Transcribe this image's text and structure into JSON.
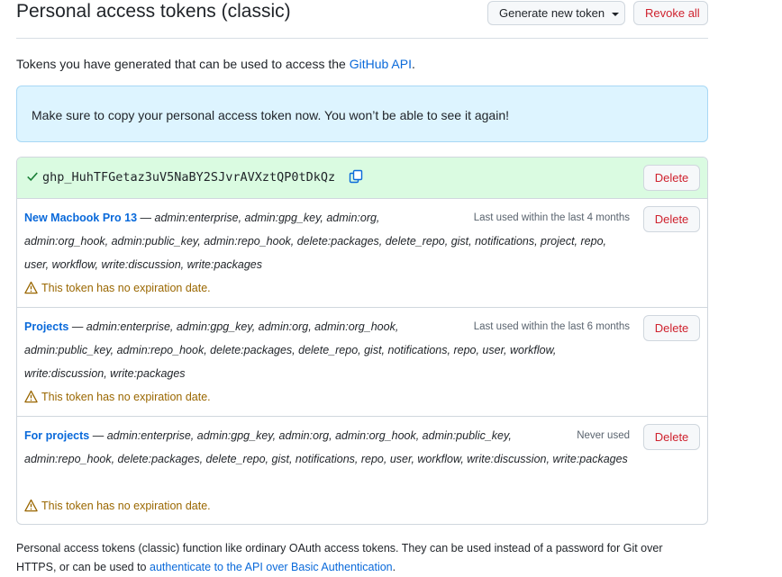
{
  "header": {
    "title": "Personal access tokens (classic)",
    "generate_label": "Generate new token",
    "revoke_label": "Revoke all"
  },
  "intro": {
    "text": "Tokens you have generated that can be used to access the ",
    "link": "GitHub API",
    "suffix": "."
  },
  "flash": {
    "message": "Make sure to copy your personal access token now. You won’t be able to see it again!"
  },
  "new_token": {
    "value": "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",
    "delete_label": "Delete"
  },
  "tokens": [
    {
      "name": "New Macbook Pro 13",
      "dash": " — ",
      "scopes": "admin:enterprise, admin:gpg_key, admin:org, admin:org_hook, admin:public_key, admin:repo_hook, delete:packages, delete_repo, gist, notifications, project, repo, user, workflow, write:discussion, write:packages",
      "last_used": "Last used within the last 4 months",
      "warning": "This token has no expiration date.",
      "delete_label": "Delete"
    },
    {
      "name": "Projects",
      "dash": " — ",
      "scopes": "admin:enterprise, admin:gpg_key, admin:org, admin:org_hook, admin:public_key, admin:repo_hook, delete:packages, delete_repo, gist, notifications, repo, user, workflow, write:discussion, write:packages",
      "last_used": "Last used within the last 6 months",
      "warning": "This token has no expiration date.",
      "delete_label": "Delete"
    },
    {
      "name": "For projects",
      "dash": " — ",
      "scopes": "admin:enterprise, admin:gpg_key, admin:org, admin:org_hook, admin:public_key, admin:repo_hook, delete:packages, delete_repo, gist, notifications, repo, user, workflow, write:discussion, write:packages",
      "last_used": "Never used",
      "warning": "This token has no expiration date.",
      "delete_label": "Delete"
    }
  ],
  "footer": {
    "text": "Personal access tokens (classic) function like ordinary OAuth access tokens. They can be used instead of a password for Git over HTTPS, or can be used to ",
    "link": "authenticate to the API over Basic Authentication",
    "suffix": "."
  },
  "colors": {
    "link": "#0969da",
    "danger": "#cf222e",
    "success_bg": "#dafbe1",
    "info_bg": "#ddf4ff",
    "warning": "#9a6700"
  },
  "icons": [
    "check-icon",
    "copy-icon",
    "alert-icon",
    "triangle-down-icon"
  ]
}
